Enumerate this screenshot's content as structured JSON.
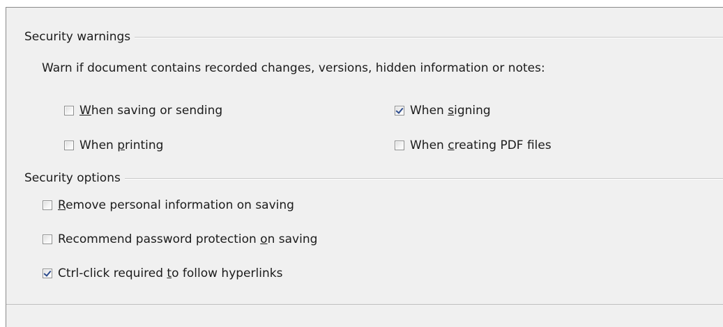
{
  "security_warnings": {
    "title": "Security warnings",
    "description": "Warn if document contains recorded changes, versions, hidden information or notes:",
    "options": [
      {
        "pre": "",
        "mnemonic": "W",
        "post": "hen saving or sending",
        "checked": false
      },
      {
        "pre": "When ",
        "mnemonic": "s",
        "post": "igning",
        "checked": true
      },
      {
        "pre": "When ",
        "mnemonic": "p",
        "post": "rinting",
        "checked": false
      },
      {
        "pre": "When ",
        "mnemonic": "c",
        "post": "reating PDF files",
        "checked": false
      }
    ]
  },
  "security_options": {
    "title": "Security options",
    "options": [
      {
        "pre": "",
        "mnemonic": "R",
        "post": "emove personal information on saving",
        "checked": false
      },
      {
        "pre": "Recommend password protection ",
        "mnemonic": "o",
        "post": "n saving",
        "checked": false
      },
      {
        "pre": "Ctrl-click required ",
        "mnemonic": "t",
        "post": "o follow hyperlinks",
        "checked": true
      }
    ]
  },
  "colors": {
    "background": "#f0f0f0",
    "checkmark": "#2c4b8c",
    "text": "#1b1b1b"
  }
}
